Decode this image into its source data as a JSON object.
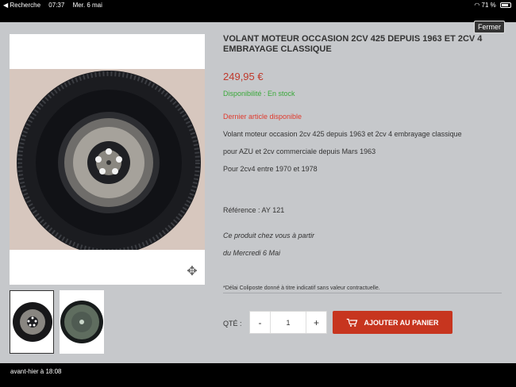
{
  "status_bar": {
    "back": "◀ Recherche",
    "time": "07:37",
    "date": "Mer. 6 mai",
    "battery": "71 %"
  },
  "header": {
    "close_label": "Fermer"
  },
  "product": {
    "title": "VOLANT MOTEUR OCCASION 2CV 425 DEPUIS 1963 ET 2CV 4 EMBRAYAGE CLASSIQUE",
    "price": "249,95 €",
    "availability": "Disponibilité : En stock",
    "last_item": "Dernier article disponible",
    "description_lines": [
      "Volant moteur occasion 2cv 425 depuis 1963 et 2cv 4 embrayage classique",
      "pour AZU et 2cv commerciale depuis Mars 1963",
      "Pour 2cv4 entre 1970 et 1978"
    ],
    "reference": "Référence : AY 121",
    "delivery_line_1": "Ce produit chez vous à partir",
    "delivery_line_2": "du Mercredi 6 Mai",
    "shipping_note": "*Délai Coliposte donné à titre indicatif sans valeur contractuelle."
  },
  "purchase": {
    "qty_label": "QTÉ :",
    "decrement": "-",
    "quantity": "1",
    "increment": "+",
    "add_to_cart": "AJOUTER AU PANIER"
  },
  "footer": {
    "timestamp": "avant-hier à 18:08"
  },
  "icons": {
    "back": "back-arrow-icon",
    "wifi": "wifi-icon",
    "battery": "battery-icon",
    "expand": "expand-arrows-icon",
    "cart": "cart-icon"
  },
  "colors": {
    "price": "#c0392b",
    "availability": "#3aa83a",
    "last_item": "#e03b2e",
    "button": "#c7351f",
    "background": "#c6c8cb"
  }
}
